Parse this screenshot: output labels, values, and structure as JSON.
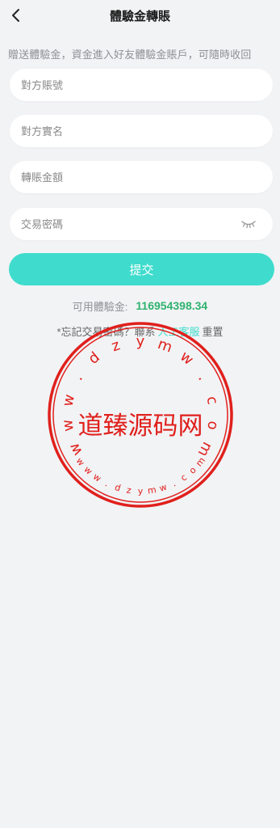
{
  "header": {
    "title": "體驗金轉賬"
  },
  "notice": "贈送體驗金，資金進入好友體驗金賬戶，可隨時收回",
  "form": {
    "account_placeholder": "對方賬號",
    "realname_placeholder": "對方實名",
    "amount_placeholder": "轉賬金額",
    "password_placeholder": "交易密碼"
  },
  "submit_label": "提交",
  "balance": {
    "label": "可用體驗金:",
    "value": "116954398.34"
  },
  "help": {
    "prefix": "*忘記交易密碼？聯系",
    "link": "人工客服",
    "suffix": "重置"
  },
  "watermark": {
    "center": "道臻源码网",
    "top_letters": [
      "w",
      "w",
      "w",
      ".",
      "d",
      "z",
      "y",
      "m",
      "w",
      ".",
      "c",
      "o",
      "m"
    ],
    "bottom_letters": [
      "w",
      "w",
      "w",
      ".",
      "d",
      "z",
      "y",
      "m",
      "w",
      ".",
      "c",
      "o",
      "m"
    ]
  },
  "colors": {
    "accent": "#3fdccd",
    "balance": "#2fb36f",
    "watermark": "#e0201c",
    "background": "#f2f3f5"
  },
  "icons": {
    "back": "chevron-left-icon",
    "eye": "eye-closed-icon"
  }
}
